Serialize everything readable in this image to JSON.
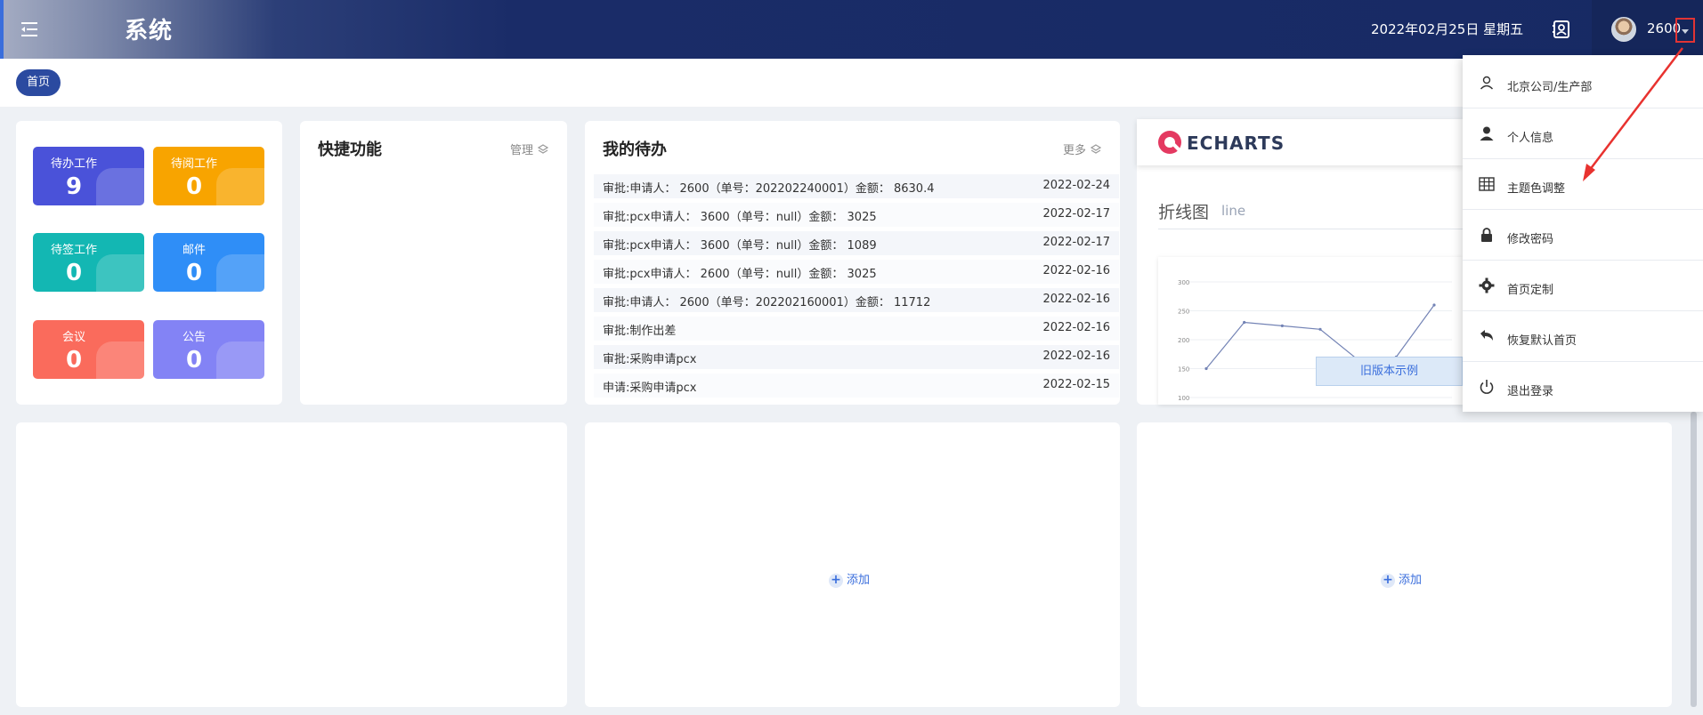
{
  "header": {
    "title": "系统",
    "date": "2022年02月25日 星期五",
    "user_name": "2600"
  },
  "tabs": {
    "home": "首页"
  },
  "stats_tiles": [
    {
      "label": "待办工作",
      "value": "9",
      "color": "#4a52d9"
    },
    {
      "label": "待阅工作",
      "value": "0",
      "color": "#f8a400"
    },
    {
      "label": "待签工作",
      "value": "0",
      "color": "#13b7b3"
    },
    {
      "label": "邮件",
      "value": "0",
      "color": "#2f8ef7"
    },
    {
      "label": "会议",
      "value": "0",
      "color": "#fa6b5c"
    },
    {
      "label": "公告",
      "value": "0",
      "color": "#8383f5"
    }
  ],
  "quick": {
    "title": "快捷功能",
    "manage": "管理"
  },
  "todo": {
    "title": "我的待办",
    "more": "更多",
    "rows": [
      {
        "text": "审批:申请人： 2600（单号：202202240001）金额： 8630.4",
        "date": "2022-02-24"
      },
      {
        "text": "审批:pcx申请人： 3600（单号：null）金额： 3025",
        "date": "2022-02-17"
      },
      {
        "text": "审批:pcx申请人： 3600（单号：null）金额： 1089",
        "date": "2022-02-17"
      },
      {
        "text": "审批:pcx申请人： 2600（单号：null）金额： 3025",
        "date": "2022-02-16"
      },
      {
        "text": "审批:申请人： 2600（单号：202202160001）金额： 11712",
        "date": "2022-02-16"
      },
      {
        "text": "审批:制作出差",
        "date": "2022-02-16"
      },
      {
        "text": "审批:采购申请pcx",
        "date": "2022-02-16"
      },
      {
        "text": "申请:采购申请pcx",
        "date": "2022-02-15"
      }
    ]
  },
  "echarts": {
    "logo": "ECHARTS",
    "title": "折线图",
    "subtitle": "line",
    "old_version": "旧版本示例"
  },
  "chart_data": {
    "type": "line",
    "yticks": [
      "300",
      "250",
      "200",
      "150",
      "100"
    ],
    "ylim": [
      100,
      300
    ],
    "values": [
      150,
      230,
      224,
      218,
      165,
      170,
      260
    ]
  },
  "empty_cards": {
    "add_label": "添加"
  },
  "user_menu": [
    {
      "label": "北京公司/生产部",
      "icon": "user-outline-icon"
    },
    {
      "label": "个人信息",
      "icon": "user-solid-icon"
    },
    {
      "label": "主题色调整",
      "icon": "grid-icon"
    },
    {
      "label": "修改密码",
      "icon": "lock-icon"
    },
    {
      "label": "首页定制",
      "icon": "gear-icon"
    },
    {
      "label": "恢复默认首页",
      "icon": "undo-icon"
    },
    {
      "label": "退出登录",
      "icon": "power-icon"
    }
  ]
}
